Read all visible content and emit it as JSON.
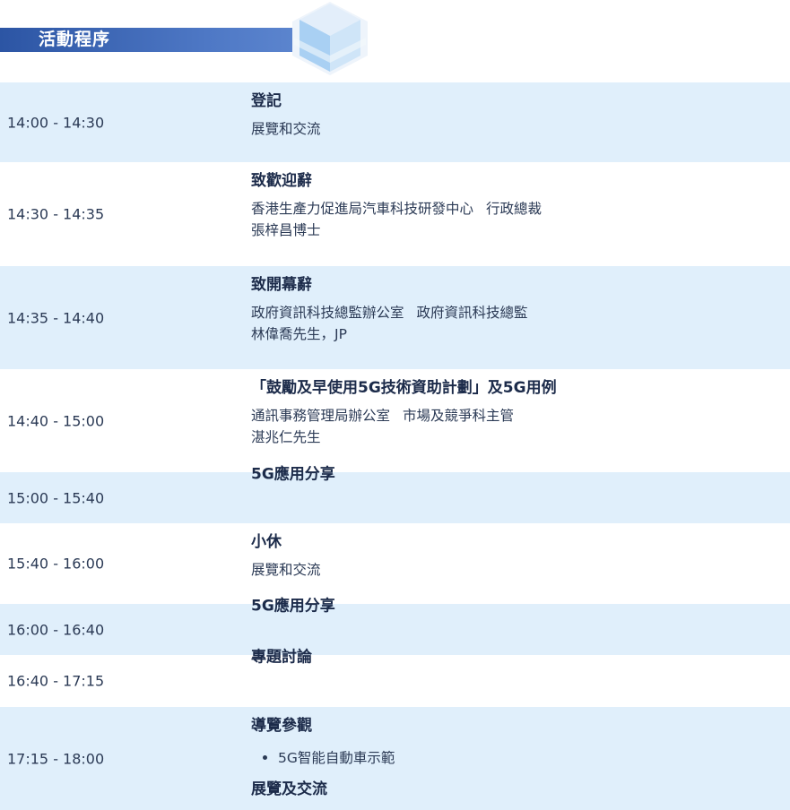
{
  "header": {
    "title": "活動程序"
  },
  "schedule": [
    {
      "time": "14:00 - 14:30",
      "title": "登記",
      "details": [
        "展覽和交流"
      ]
    },
    {
      "time": "14:30 - 14:35",
      "title": "致歡迎辭",
      "org": "香港生產力促進局汽車科技研發中心",
      "role": "行政總裁",
      "person": "張梓昌博士"
    },
    {
      "time": "14:35 - 14:40",
      "title": "致開幕辭",
      "org": "政府資訊科技總監辦公室",
      "role": "政府資訊科技總監",
      "person": "林偉喬先生，JP"
    },
    {
      "time": "14:40 - 15:00",
      "title": "「鼓勵及早使用5G技術資助計劃」及5G用例",
      "org": "通訊事務管理局辦公室",
      "role": "市場及競爭科主管",
      "person": "湛兆仁先生"
    },
    {
      "time": "15:00 - 15:40",
      "title": "5G應用分享"
    },
    {
      "time": "15:40 - 16:00",
      "title": "小休",
      "details": [
        "展覽和交流"
      ]
    },
    {
      "time": "16:00 - 16:40",
      "title": "5G應用分享"
    },
    {
      "time": "16:40 - 17:15",
      "title": "專題討論"
    },
    {
      "time": "17:15 - 18:00",
      "title": "導覽參觀",
      "bullets": [
        "5G智能自動車示範"
      ],
      "subtitle": "展覽及交流"
    }
  ],
  "colors": {
    "header_bar": "#2c55a4",
    "row_shade": "#e0effb",
    "text": "#1f2d4a"
  }
}
